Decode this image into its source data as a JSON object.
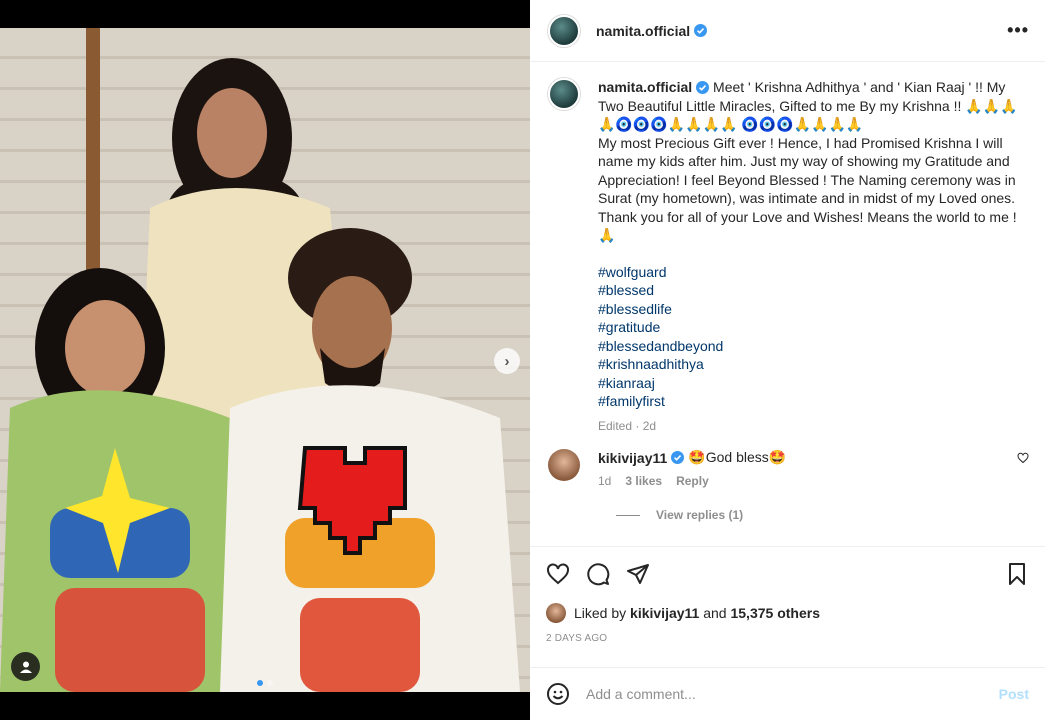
{
  "header": {
    "username": "namita.official",
    "more_icon": "more-horizontal-icon"
  },
  "caption": {
    "username": "namita.official",
    "text": "Meet ' Krishna Adhithya ' and ' Kian Raaj ' !! My Two Beautiful Little Miracles, Gifted to me By my Krishna !! 🙏🙏🙏🙏🧿🧿🧿🙏🙏🙏🙏 🧿🧿🧿🙏🙏🙏🙏\nMy most Precious Gift ever ! Hence, I had Promised Krishna I will name my kids after him. Just my way of showing my Gratitude and Appreciation! I feel Beyond Blessed ! The Naming ceremony was in Surat (my hometown), was intimate and in midst of my Loved ones. Thank you for all of your Love and Wishes! Means the world to me ! 🙏",
    "hashtags": [
      "#wolfguard",
      "#blessed",
      "#blessedlife",
      "#gratitude",
      "#blessedandbeyond",
      "#krishnaadhithya",
      "#kianraaj",
      "#familyfirst"
    ],
    "edited": "Edited · 2d"
  },
  "comment": {
    "username": "kikivijay11",
    "text": "🤩God bless🤩",
    "time": "1d",
    "likes": "3 likes",
    "reply": "Reply",
    "view_replies": "View replies (1)"
  },
  "actions": {
    "liked_by_prefix": "Liked by ",
    "liked_by_user": "kikivijay11",
    "liked_and": " and ",
    "liked_others": "15,375 others",
    "date": "2 DAYS AGO"
  },
  "add_comment": {
    "placeholder": "Add a comment...",
    "post_label": "Post"
  },
  "colors": {
    "link": "#00376b",
    "verified": "#3897f0",
    "post_disabled": "#b2dffc"
  }
}
